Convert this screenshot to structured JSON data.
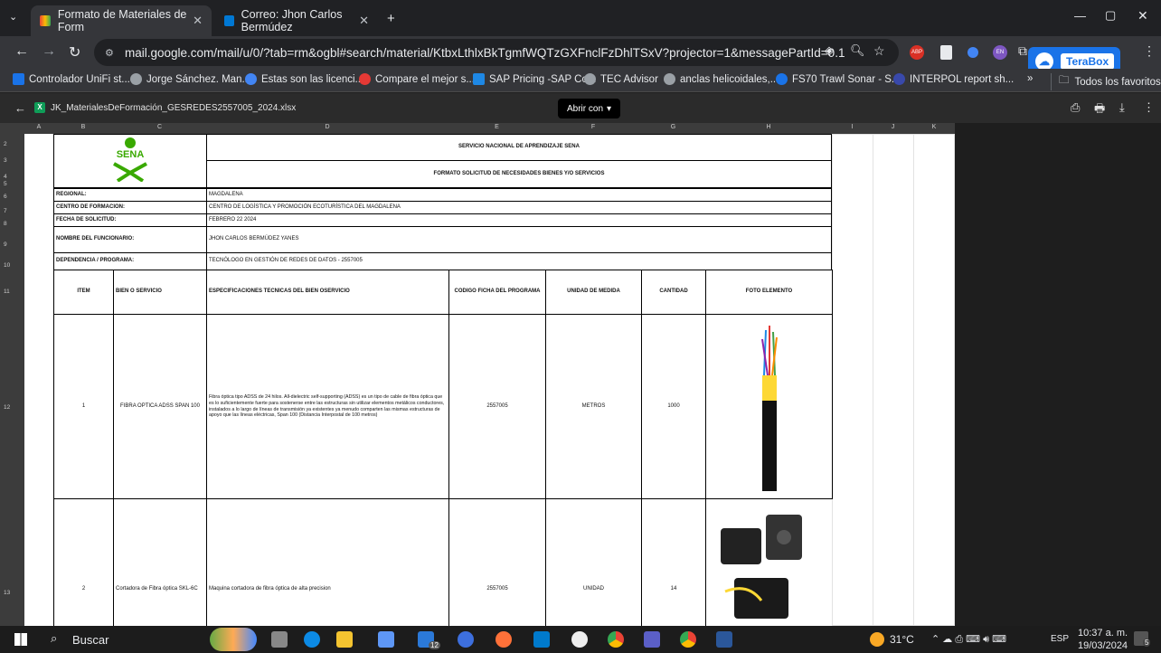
{
  "tabs": [
    {
      "label": "Formato de Materiales de Form",
      "active": true
    },
    {
      "label": "Correo: Jhon Carlos Bermúdez",
      "active": false
    }
  ],
  "address_bar": {
    "url": "mail.google.com/mail/u/0/?tab=rm&ogbl#search/material/KtbxLthlxBkTgmfWQTzGXFnclFzDhlTSxV?projector=1&messagePartId=0.1"
  },
  "terabox": {
    "label": "TeraBox"
  },
  "bookmarks": [
    "Controlador UniFi st...",
    "Jorge Sánchez. Man...",
    "Estas son las licenci...",
    "Compare el mejor s...",
    "SAP Pricing -SAP Co...",
    "TEC Advisor",
    "anclas helicoidales,...",
    "FS70 Trawl Sonar - S...",
    "INTERPOL report sh..."
  ],
  "bookmarks_more": "»",
  "all_bookmarks": "Todos los favoritos",
  "viewer": {
    "filename": "JK_MaterialesDeFormación_GESREDES2557005_2024.xlsx",
    "open_with": "Abrir con"
  },
  "columns": [
    "A",
    "B",
    "C",
    "D",
    "E",
    "F",
    "G",
    "H",
    "I",
    "J",
    "K"
  ],
  "rows": [
    "2",
    "3",
    "4",
    "5",
    "6",
    "7",
    "8",
    "9",
    "10",
    "11",
    "12",
    "13"
  ],
  "doc": {
    "logo_text": "SENA",
    "title1": "SERVICIO NACIONAL DE APRENDIZAJE SENA",
    "title2": "FORMATO SOLICITUD DE NECESIDADES BIENES Y/O SERVICIOS",
    "info": [
      {
        "label": "REGIONAL:",
        "value": "MAGDALENA"
      },
      {
        "label": "CENTRO DE FORMACION:",
        "value": "CENTRO DE LOGÍSTICA Y PROMOCIÓN ECOTURÍSTICA DEL MAGDALENA"
      },
      {
        "label": "FECHA DE SOLICITUD:",
        "value": "FEBRERO 22 2024"
      },
      {
        "label": "NOMBRE DEL FUNCIONARIO:",
        "value": "JHON CARLOS BERMÚDEZ YANES"
      },
      {
        "label": "DEPENDENCIA / PROGRAMA:",
        "value": "TECNÓLOGO EN GESTIÓN DE REDES DE DATOS - 2557005"
      }
    ],
    "headers": [
      "ITEM",
      "BIEN O SERVICIO",
      "ESPECIFICACIONES TECNICAS DEL BIEN OSERVICIO",
      "CODIGO FICHA DEL PROGRAMA",
      "UNIDAD DE MEDIDA",
      "CANTIDAD",
      "FOTO ELEMENTO"
    ],
    "items": [
      {
        "item": "1",
        "bien": "FIBRA OPTICA ADSS SPAN 100",
        "spec": "Fibra óptica tipo ADSS de 24 hilos. All-dielectric self-supporting (ADSS) es un tipo de cable de fibra óptica que es lo suficientemente fuerte para sostenerse entre las estructuras sin utilizar elementos metálicos conductores, instalados a lo largo de líneas de transmisión ya existentes ya menudo comparten las mismas estructuras de apoyo que las líneas eléctricas, Span 100 (Distancia Interpostal de 100 metros)",
        "codigo": "2557005",
        "unidad": "METROS",
        "cantidad": "1000"
      },
      {
        "item": "2",
        "bien": "Cortadora de Fibra óptica SKL-6C",
        "spec": "Maquina cortadora de fibra óptica de alta precision",
        "codigo": "2557005",
        "unidad": "UNIDAD",
        "cantidad": "14"
      }
    ]
  },
  "taskbar": {
    "search": "Buscar",
    "temp": "31°C",
    "lang": "ESP",
    "time": "10:37 a. m.",
    "date": "19/03/2024",
    "notif": "5",
    "badge": "12"
  }
}
